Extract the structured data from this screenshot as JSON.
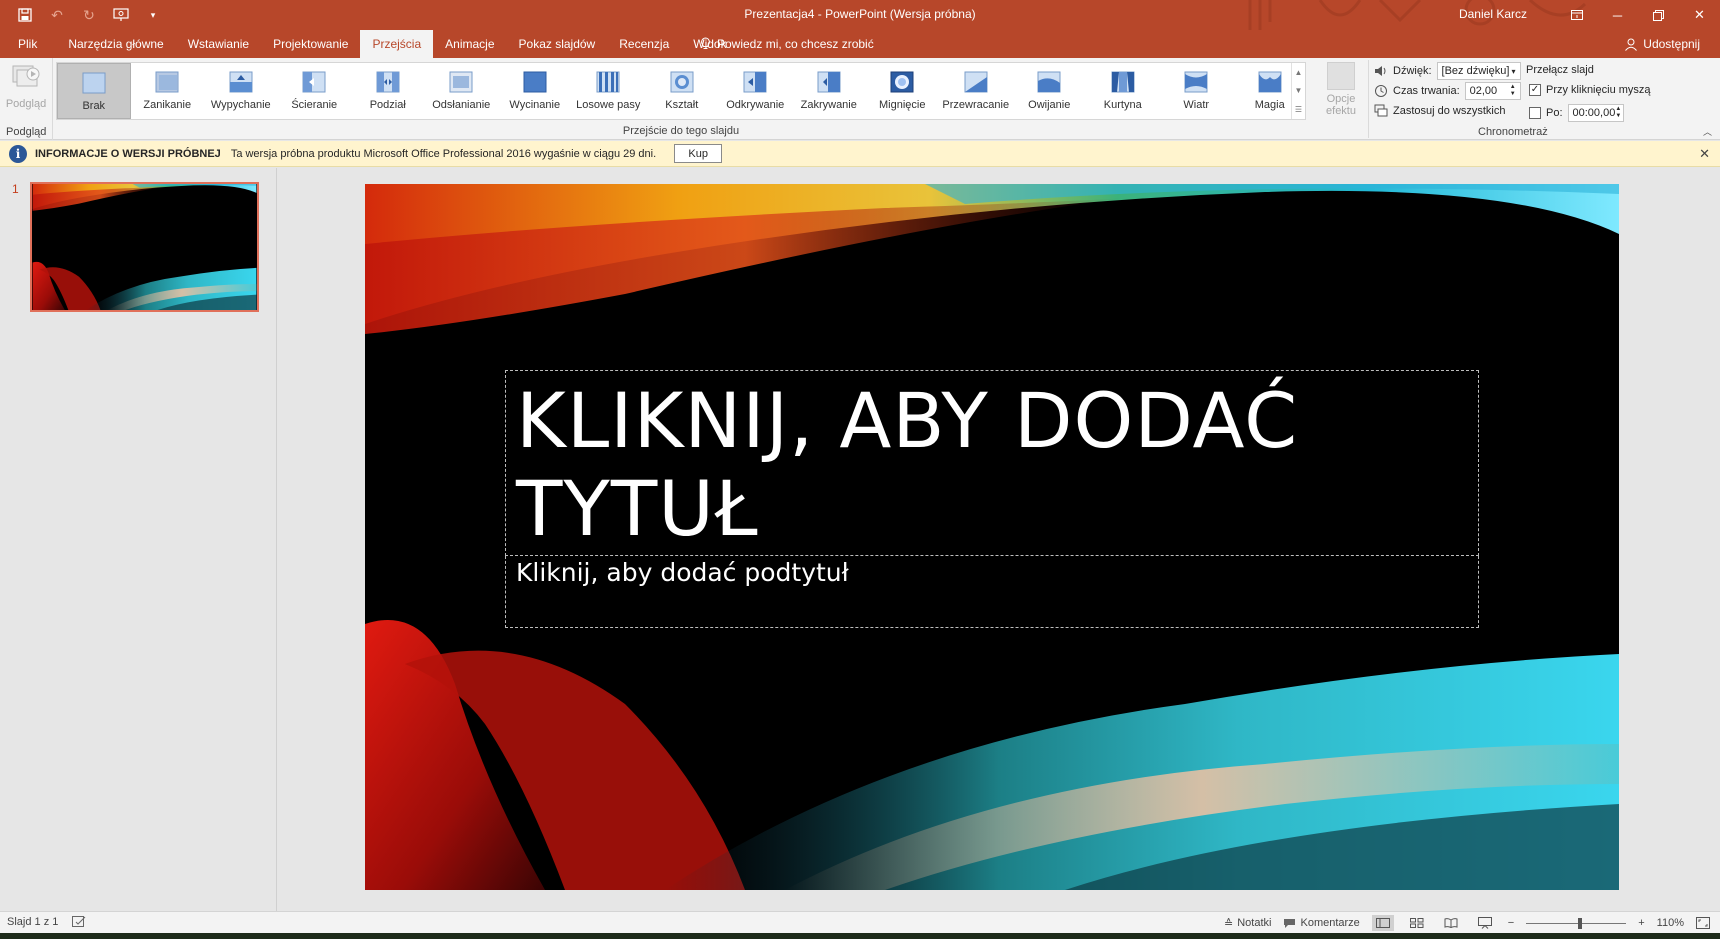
{
  "window": {
    "title": "Prezentacja4  -  PowerPoint (Wersja próbna)",
    "user": "Daniel Karcz"
  },
  "tabs": [
    {
      "label": "Plik"
    },
    {
      "label": "Narzędzia główne"
    },
    {
      "label": "Wstawianie"
    },
    {
      "label": "Projektowanie"
    },
    {
      "label": "Przejścia",
      "active": true
    },
    {
      "label": "Animacje"
    },
    {
      "label": "Pokaz slajdów"
    },
    {
      "label": "Recenzja"
    },
    {
      "label": "Widok"
    }
  ],
  "tellme": "Powiedz mi, co chcesz zrobić",
  "share": "Udostępnij",
  "ribbon": {
    "preview_label": "Podgląd",
    "preview_group": "Podgląd",
    "transitions": [
      {
        "label": "Brak",
        "selected": true
      },
      {
        "label": "Zanikanie"
      },
      {
        "label": "Wypychanie"
      },
      {
        "label": "Ścieranie"
      },
      {
        "label": "Podział"
      },
      {
        "label": "Odsłanianie"
      },
      {
        "label": "Wycinanie"
      },
      {
        "label": "Losowe pasy"
      },
      {
        "label": "Kształt"
      },
      {
        "label": "Odkrywanie"
      },
      {
        "label": "Zakrywanie"
      },
      {
        "label": "Mignięcie"
      },
      {
        "label": "Przewracanie"
      },
      {
        "label": "Owijanie"
      },
      {
        "label": "Kurtyna"
      },
      {
        "label": "Wiatr"
      },
      {
        "label": "Magia"
      }
    ],
    "transitions_group": "Przejście do tego slajdu",
    "effect_options_line1": "Opcje",
    "effect_options_line2": "efektu",
    "timing": {
      "sound_label": "Dźwięk:",
      "sound_value": "[Bez dźwięku]",
      "duration_label": "Czas trwania:",
      "duration_value": "02,00",
      "apply_all": "Zastosuj do wszystkich",
      "advance_title": "Przełącz slajd",
      "on_click": "Przy kliknięciu myszą",
      "on_click_checked": true,
      "after_label": "Po:",
      "after_checked": false,
      "after_value": "00:00,00",
      "group": "Chronometraż"
    }
  },
  "infobar": {
    "title": "INFORMACJE O WERSJI PRÓBNEJ",
    "message": "Ta wersja próbna produktu Microsoft Office Professional 2016 wygaśnie w ciągu 29 dni.",
    "buy": "Kup"
  },
  "thumbnails": [
    {
      "number": "1"
    }
  ],
  "slide": {
    "title": "KLIKNIJ, ABY DODAĆ TYTUŁ",
    "subtitle": "Kliknij, aby dodać podtytuł"
  },
  "status": {
    "slide_info": "Slajd 1 z 1",
    "notes": "Notatki",
    "comments": "Komentarze",
    "zoom_minus": "−",
    "zoom_plus": "+",
    "zoom": "110%"
  },
  "colors": {
    "accent": "#b7472a",
    "ribbon_bg": "#f3f3f3",
    "infobar_bg": "#fff4ce"
  }
}
